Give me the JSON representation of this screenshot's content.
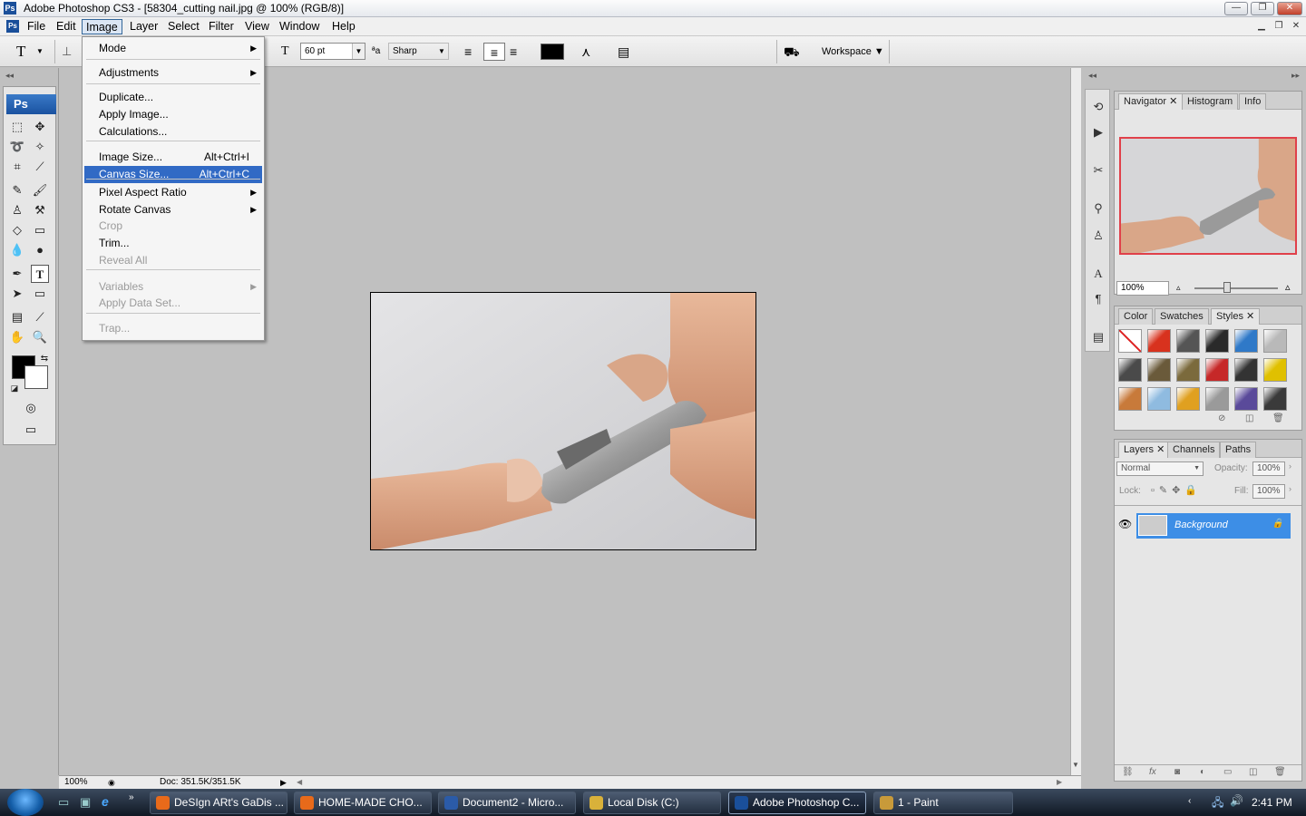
{
  "window": {
    "title": "Adobe Photoshop CS3 - [58304_cutting nail.jpg @ 100% (RGB/8)]",
    "app_icon": "Ps",
    "minimize": "—",
    "maximize": "❐",
    "close": "✕"
  },
  "menubar": {
    "items": [
      "File",
      "Edit",
      "Image",
      "Layer",
      "Select",
      "Filter",
      "View",
      "Window",
      "Help"
    ],
    "active": "Image"
  },
  "options": {
    "font_size": "60 pt",
    "antialias_icon": "ªa",
    "antialias": "Sharp",
    "workspace": "Workspace ▼"
  },
  "image_menu": {
    "items": [
      {
        "label": "Mode",
        "shortcut": "",
        "submenu": true,
        "disabled": false
      },
      {
        "label": "Adjustments",
        "shortcut": "",
        "submenu": true,
        "disabled": false
      },
      {
        "label": "Duplicate...",
        "shortcut": "",
        "submenu": false,
        "disabled": false
      },
      {
        "label": "Apply Image...",
        "shortcut": "",
        "submenu": false,
        "disabled": false
      },
      {
        "label": "Calculations...",
        "shortcut": "",
        "submenu": false,
        "disabled": false
      },
      {
        "label": "Image Size...",
        "shortcut": "Alt+Ctrl+I",
        "submenu": false,
        "disabled": false
      },
      {
        "label": "Canvas Size...",
        "shortcut": "Alt+Ctrl+C",
        "submenu": false,
        "disabled": false,
        "highlighted": true
      },
      {
        "label": "Pixel Aspect Ratio",
        "shortcut": "",
        "submenu": true,
        "disabled": false
      },
      {
        "label": "Rotate Canvas",
        "shortcut": "",
        "submenu": true,
        "disabled": false
      },
      {
        "label": "Crop",
        "shortcut": "",
        "submenu": false,
        "disabled": true
      },
      {
        "label": "Trim...",
        "shortcut": "",
        "submenu": false,
        "disabled": false
      },
      {
        "label": "Reveal All",
        "shortcut": "",
        "submenu": false,
        "disabled": true
      },
      {
        "label": "Variables",
        "shortcut": "",
        "submenu": true,
        "disabled": true
      },
      {
        "label": "Apply Data Set...",
        "shortcut": "",
        "submenu": false,
        "disabled": true
      },
      {
        "label": "Trap...",
        "shortcut": "",
        "submenu": false,
        "disabled": true
      }
    ]
  },
  "toolbox": {
    "logo": "Ps"
  },
  "status": {
    "zoom": "100%",
    "doc": "Doc: 351.5K/351.5K"
  },
  "navigator": {
    "tabs": [
      "Navigator",
      "Histogram",
      "Info"
    ],
    "zoom": "100%"
  },
  "styles_panel": {
    "tabs": [
      "Color",
      "Swatches",
      "Styles"
    ],
    "swatch_colors": [
      "#ffffff",
      "#d8321e",
      "#555555",
      "#2a2a2a",
      "#2f79c8",
      "#b9b9b9",
      "#4a4a4a",
      "#6a5a3a",
      "#7b6a3c",
      "#c62828",
      "#333333",
      "#e0c000",
      "#c87a3a",
      "#8fbbe0",
      "#e0a020",
      "#9a9a9a",
      "#5a4a9a",
      "#3a3a3a"
    ]
  },
  "layers_panel": {
    "tabs": [
      "Layers",
      "Channels",
      "Paths"
    ],
    "blend_mode": "Normal",
    "opacity_label": "Opacity:",
    "opacity": "100%",
    "lock_label": "Lock:",
    "fill_label": "Fill:",
    "fill": "100%",
    "layer_name": "Background"
  },
  "taskbar": {
    "tasks": [
      {
        "label": "DeSIgn ARt's GaDis ...",
        "icon_color": "#e86a1a",
        "active": false
      },
      {
        "label": "HOME-MADE CHO...",
        "icon_color": "#e86a1a",
        "active": false
      },
      {
        "label": "Document2 - Micro...",
        "icon_color": "#2b5ba8",
        "active": false
      },
      {
        "label": "Local Disk (C:)",
        "icon_color": "#d9b13a",
        "active": false
      },
      {
        "label": "Adobe Photoshop C...",
        "icon_color": "#1a4f9a",
        "active": true
      },
      {
        "label": "1 - Paint",
        "icon_color": "#c89a3a",
        "active": false
      }
    ],
    "clock": "2:41 PM"
  }
}
